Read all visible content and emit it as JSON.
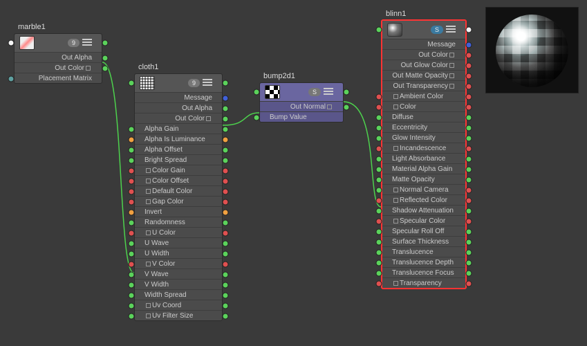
{
  "nodes": {
    "marble": {
      "title": "marble1",
      "counter": "9",
      "outputs": [
        "Out Alpha",
        "Out Color",
        "Placement Matrix"
      ]
    },
    "cloth": {
      "title": "cloth1",
      "counter": "9",
      "outputs": [
        "Message",
        "Out Alpha",
        "Out Color"
      ],
      "inputs": [
        "Alpha Gain",
        "Alpha Is Luminance",
        "Alpha Offset",
        "Bright Spread",
        "Color Gain",
        "Color Offset",
        "Default Color",
        "Gap Color",
        "Invert",
        "Randomness",
        "U Color",
        "U Wave",
        "U Width",
        "V Color",
        "V Wave",
        "V Width",
        "Width Spread",
        "Uv Coord",
        "Uv Filter Size"
      ]
    },
    "bump": {
      "title": "bump2d1",
      "counter": "S",
      "outputs": [
        "Out Normal"
      ],
      "inputs": [
        "Bump Value"
      ]
    },
    "blinn": {
      "title": "blinn1",
      "counter": "S",
      "outputs": [
        "Message",
        "Out Color",
        "Out Glow Color",
        "Out Matte Opacity",
        "Out Transparency"
      ],
      "inputs": [
        "Ambient Color",
        "Color",
        "Diffuse",
        "Eccentricity",
        "Glow Intensity",
        "Incandescence",
        "Light Absorbance",
        "Material Alpha Gain",
        "Matte Opacity",
        "Normal Camera",
        "Reflected Color",
        "Shadow Attenuation",
        "Specular Color",
        "Specular Roll Off",
        "Surface Thickness",
        "Translucence",
        "Translucence Depth",
        "Translucence Focus",
        "Transparency"
      ]
    }
  },
  "colors": {
    "wire": "#4dd24d"
  }
}
